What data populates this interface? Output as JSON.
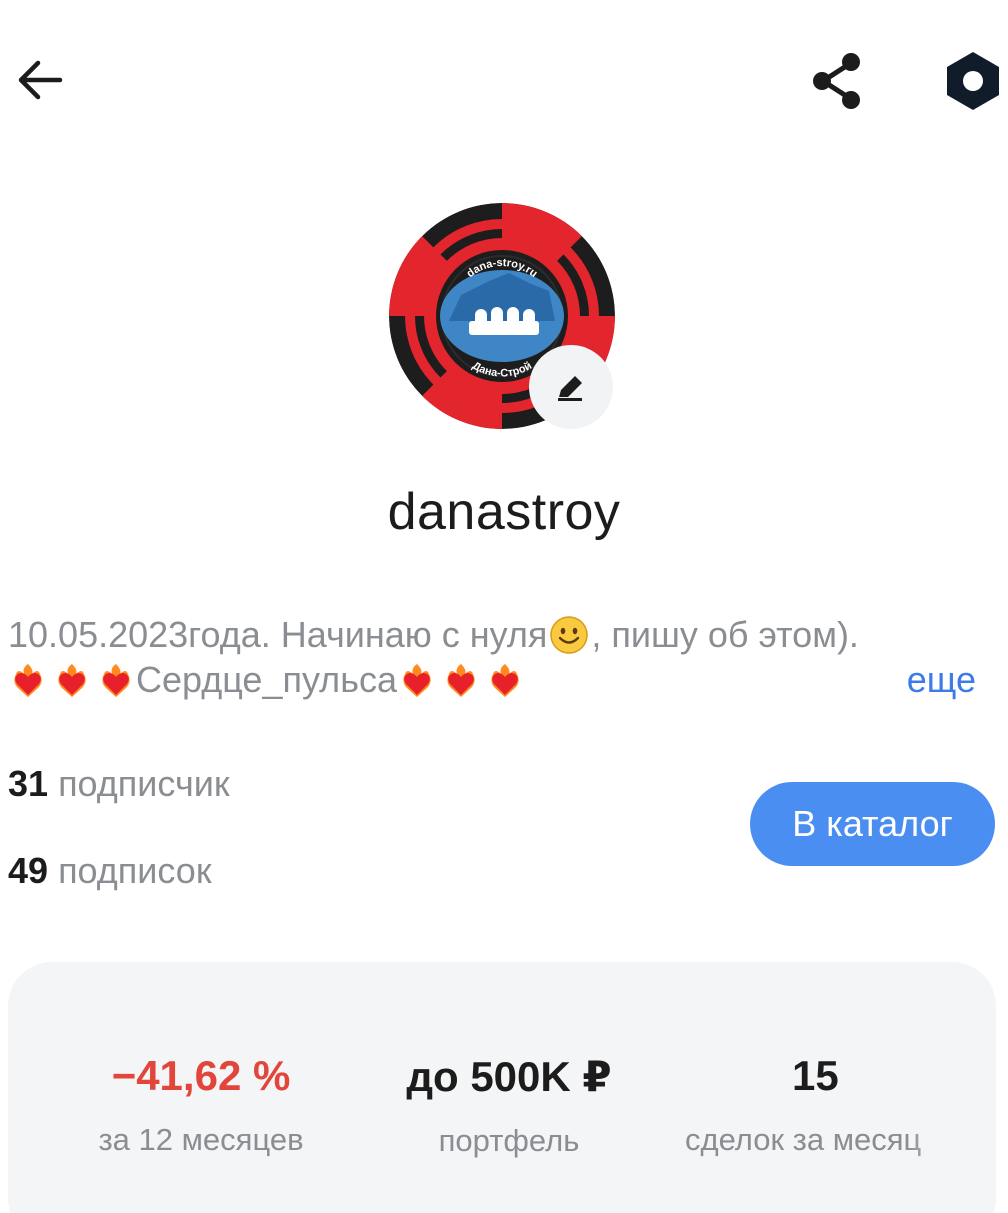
{
  "header": {
    "back_icon": "arrow-left-icon",
    "share_icon": "share-icon",
    "settings_icon": "hexagon-settings-icon"
  },
  "avatar": {
    "top_text": "dana-stroy.ru",
    "bottom_text": "Дана-Строй",
    "colors": {
      "red": "#e3252d",
      "dark": "#1d1d1d",
      "blue": "#3f86c6"
    },
    "edit_icon": "pencil-icon"
  },
  "profile": {
    "username": "danastroy",
    "bio_line1": "10.05.2023года.  Начинаю с нуля",
    "bio_line1_after": ", пишу об этом).",
    "bio_line2": "Сердце_пульса",
    "more_label": "еще"
  },
  "counts": {
    "followers_num": "31",
    "followers_label": "подписчик",
    "following_num": "49",
    "following_label": "подписок"
  },
  "catalog_button": "В каталог",
  "stats": [
    {
      "value": "−41,62 %",
      "label": "за 12 месяцев",
      "color": "#e2463a"
    },
    {
      "value": "до 500K ₽",
      "label": "портфель"
    },
    {
      "value": "15",
      "label": "сделок за месяц"
    }
  ],
  "colors": {
    "accent": "#4b8ef1",
    "link": "#3d7be8",
    "negative": "#e2463a"
  }
}
